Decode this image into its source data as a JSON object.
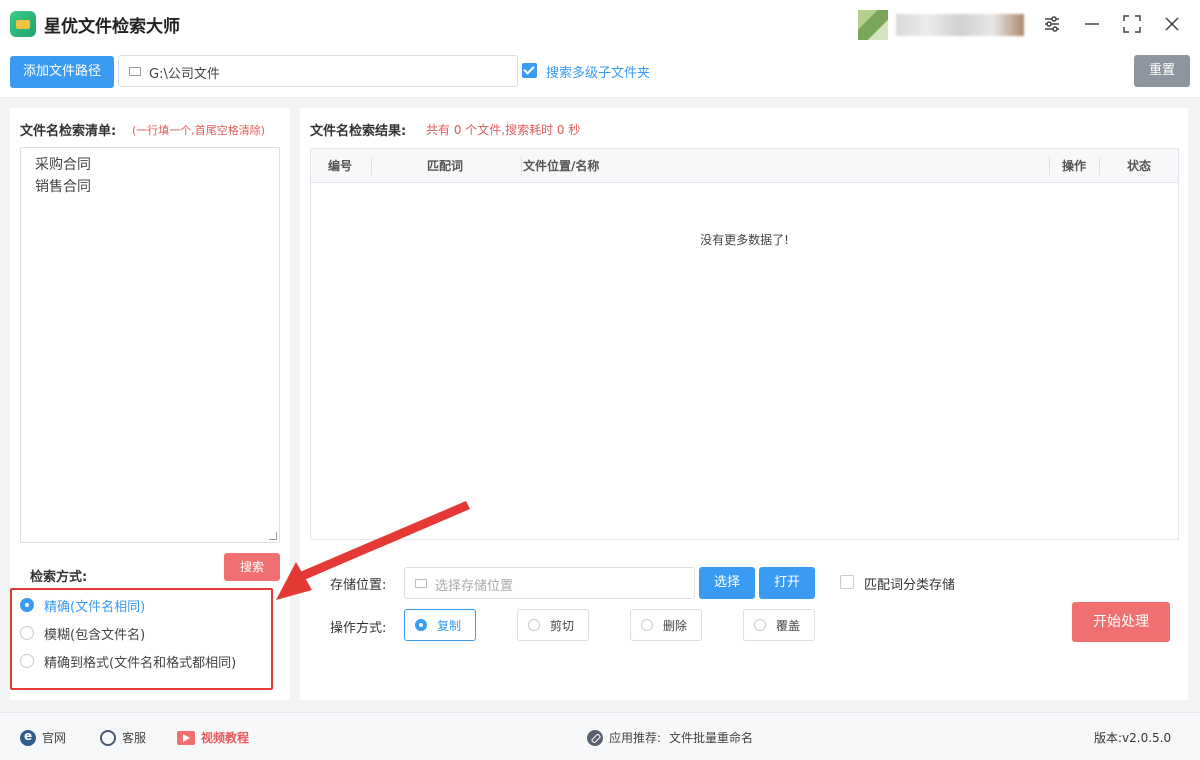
{
  "app": {
    "title": "星优文件检索大师"
  },
  "window_controls": [
    "settings",
    "minimize",
    "maximize",
    "close"
  ],
  "toolbar": {
    "add_path_label": "添加文件路径",
    "path_value": "G:\\公司文件",
    "multi_level_checked": true,
    "multi_level_label": "搜索多级子文件夹",
    "reset_label": "重置"
  },
  "left": {
    "list_title": "文件名检索清单:",
    "list_hint": "(一行填一个,首尾空格清除)",
    "keywords": "采购合同\n销售合同",
    "mode_label": "检索方式:",
    "search_button": "搜索",
    "modes": [
      {
        "label": "精确(文件名相同)",
        "selected": true
      },
      {
        "label": "模糊(包含文件名)",
        "selected": false
      },
      {
        "label": "精确到格式(文件名和格式都相同)",
        "selected": false
      }
    ]
  },
  "results": {
    "title": "文件名检索结果:",
    "summary": "共有 0 个文件,搜索耗时 0 秒",
    "columns": [
      "编号",
      "匹配词",
      "文件位置/名称",
      "操作",
      "状态"
    ],
    "empty_text": "没有更多数据了!"
  },
  "storage": {
    "label": "存储位置:",
    "placeholder": "选择存储位置",
    "choose_button": "选择",
    "open_button": "打开",
    "classify_checked": false,
    "classify_label": "匹配词分类存储"
  },
  "operation": {
    "label": "操作方式:",
    "options": [
      {
        "label": "复制",
        "selected": true
      },
      {
        "label": "剪切",
        "selected": false
      },
      {
        "label": "删除",
        "selected": false
      },
      {
        "label": "覆盖",
        "selected": false
      }
    ],
    "start_button": "开始处理"
  },
  "footer": {
    "website": "官网",
    "support": "客服",
    "video": "视频教程",
    "recommend_prefix": "应用推荐:",
    "recommend_app": "文件批量重命名",
    "version": "版本:v2.0.5.0"
  },
  "colors": {
    "primary": "#3a9bf2",
    "danger": "#f07070",
    "highlight": "#e53935"
  }
}
